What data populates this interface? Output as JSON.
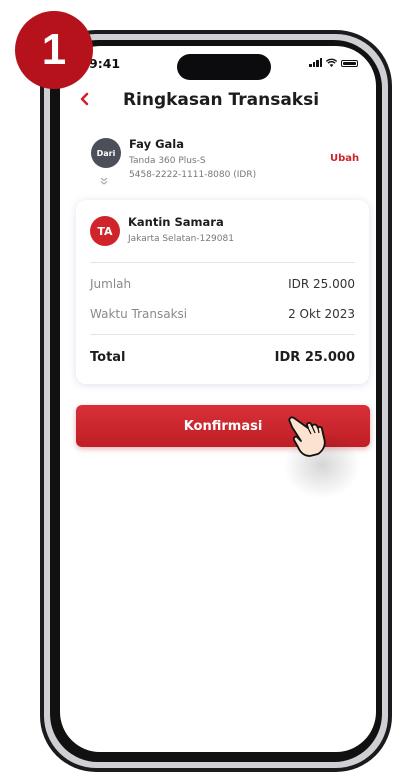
{
  "step": "1",
  "status_bar": {
    "time": "9:41"
  },
  "header": {
    "title": "Ringkasan Transaksi"
  },
  "from": {
    "badge": "Dari",
    "name": "Fay Gala",
    "product": "Tanda 360 Plus-S",
    "account": "5458-2222-1111-8080 (IDR)",
    "change_label": "Ubah"
  },
  "to": {
    "initials": "TA",
    "name": "Kantin Samara",
    "location": "Jakarta Selatan-129081"
  },
  "details": [
    {
      "label": "Jumlah",
      "value": "IDR 25.000"
    },
    {
      "label": "Waktu Transaksi",
      "value": "2 Okt 2023"
    }
  ],
  "total": {
    "label": "Total",
    "value": "IDR 25.000"
  },
  "confirm_button": {
    "label": "Konfirmasi"
  },
  "colors": {
    "accent": "#d0242b",
    "badge": "#b5121b",
    "avatar_from": "#4a4f5a"
  }
}
